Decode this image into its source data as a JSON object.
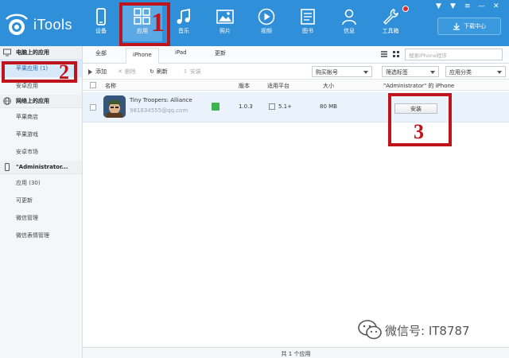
{
  "app": {
    "name": "iTools"
  },
  "nav": [
    {
      "label": "设备",
      "icon": "phone-icon"
    },
    {
      "label": "应用",
      "icon": "apps-grid-icon"
    },
    {
      "label": "音乐",
      "icon": "music-note-icon"
    },
    {
      "label": "照片",
      "icon": "photo-icon"
    },
    {
      "label": "视频",
      "icon": "play-icon"
    },
    {
      "label": "图书",
      "icon": "book-icon"
    },
    {
      "label": "信息",
      "icon": "user-icon"
    },
    {
      "label": "工具箱",
      "icon": "wrench-icon"
    }
  ],
  "download_center": {
    "label": "下载中心"
  },
  "sidebar": {
    "section_pc": "电脑上的应用",
    "pc_items": [
      "苹果应用 (1)",
      "安卓应用"
    ],
    "section_web": "网络上的应用",
    "web_items": [
      "苹果商店",
      "苹果游戏",
      "安卓市场"
    ],
    "section_device": "\"Administrator...",
    "device_items": [
      "应用 (30)",
      "可更新",
      "微信管理",
      "微信表情管理"
    ]
  },
  "tabs": [
    "全部",
    "iPhone",
    "iPad",
    "更新"
  ],
  "search": {
    "placeholder": "搜索iPhone程序"
  },
  "toolbar": {
    "add": "添加",
    "delete": "删除",
    "refresh": "刷新",
    "install": "安装",
    "account_dropdown": "购买帐号",
    "filter_dropdown": "筛选标签",
    "category_dropdown": "应用分类"
  },
  "table": {
    "headers": {
      "name": "名称",
      "version": "版本",
      "platform": "适用平台",
      "size": "大小",
      "device": "\"Administrator\" 的 iPhone"
    },
    "row": {
      "name": "Tiny Troopers: Alliance",
      "account": "981834555@qq.com",
      "version": "1.0.3",
      "platform": "5.1+",
      "size": "80 MB",
      "action": "安装"
    }
  },
  "footer": {
    "text": "共 1 个应用"
  },
  "annotations": [
    "1",
    "2",
    "3"
  ],
  "watermark": {
    "text": "微信号: IT8787"
  },
  "colors": {
    "accent": "#2f8fd8",
    "annotation": "#c0141c",
    "row_selected": "#eaf3fc"
  }
}
